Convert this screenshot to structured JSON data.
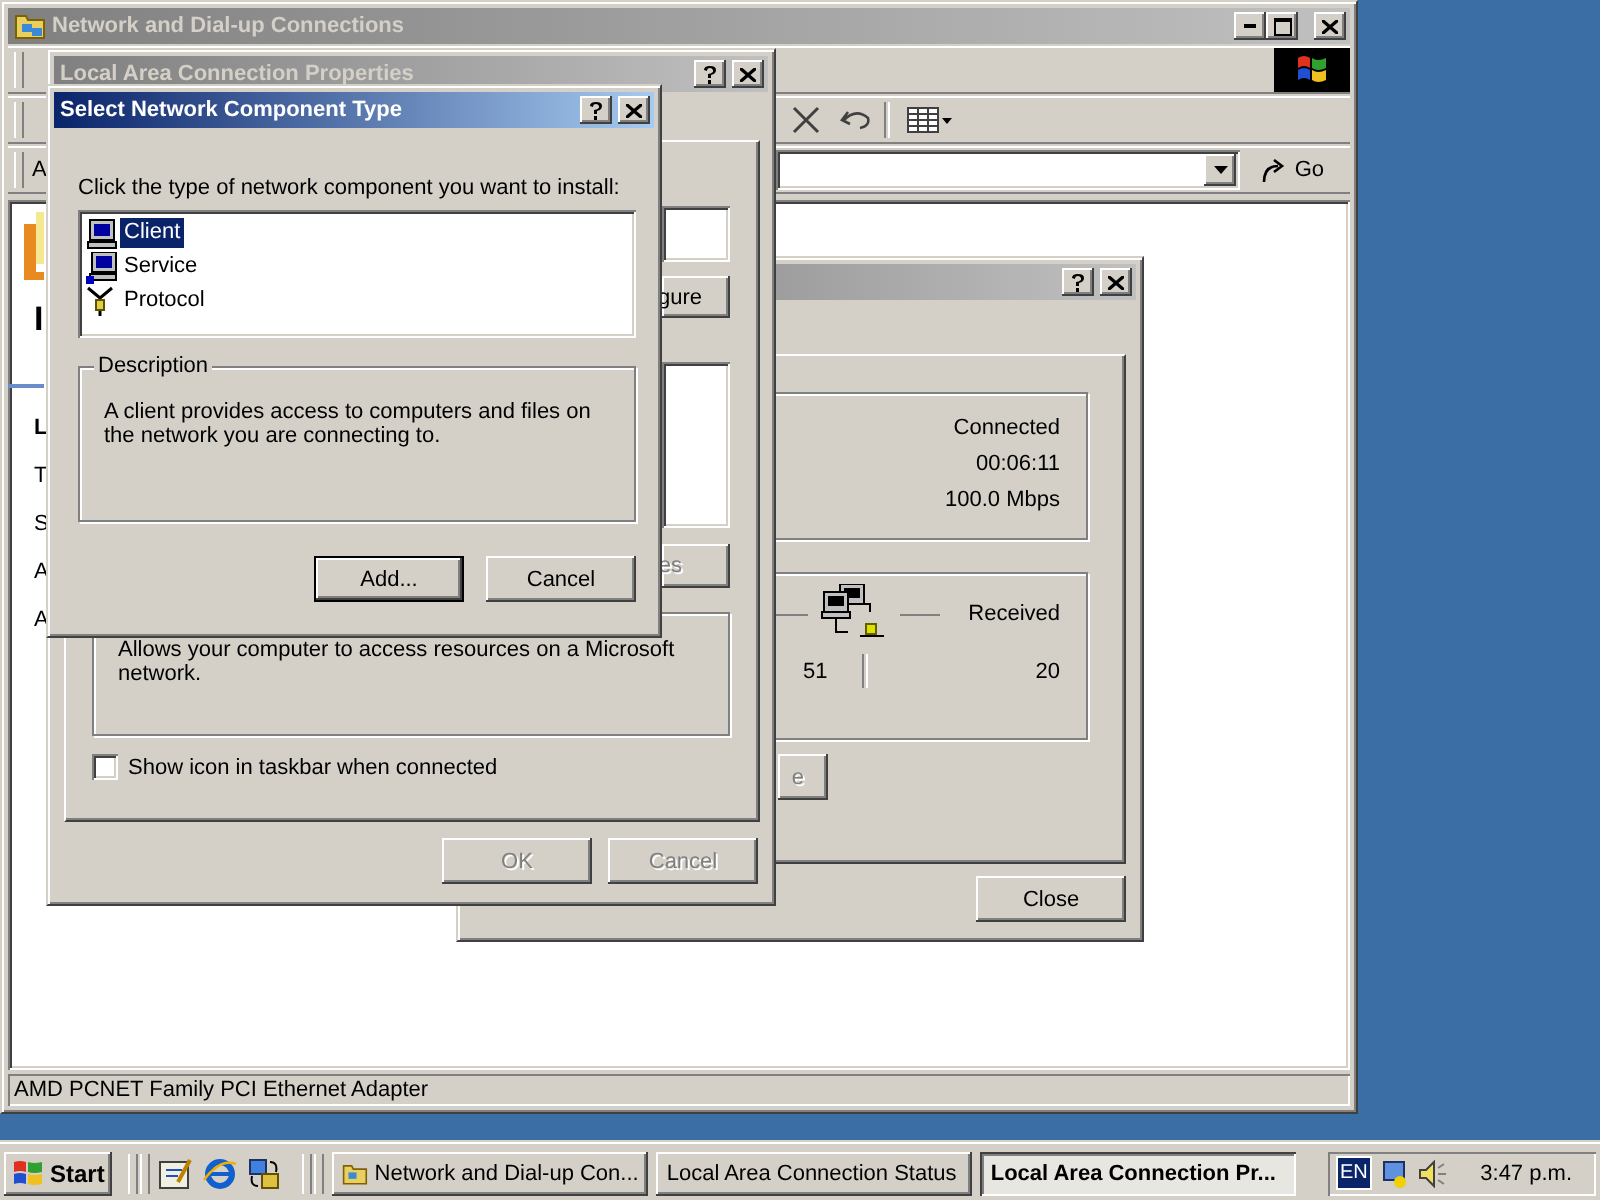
{
  "explorer": {
    "title": "Network and Dial-up Connections",
    "active": false,
    "address_label": "A",
    "go_button": "Go",
    "left_pane": [
      {
        "text": "I",
        "kind": "heading"
      },
      {
        "text": "L",
        "kind": "label"
      },
      {
        "text": "T",
        "kind": "text"
      },
      {
        "text": "S",
        "kind": "text"
      },
      {
        "text": "A",
        "kind": "text"
      },
      {
        "text": "A",
        "kind": "text"
      }
    ],
    "status_bar": "AMD PCNET Family PCI Ethernet Adapter"
  },
  "properties": {
    "title": "Local Area Connection Properties",
    "active": false,
    "configure_button": "gure",
    "properties_button": {
      "label": "es",
      "disabled": true
    },
    "description": "Allows your computer to access resources on a Microsoft network.",
    "show_icon_checkbox": {
      "label": "Show icon in taskbar when connected",
      "checked": false
    },
    "buttons": [
      {
        "label": "OK",
        "disabled": true
      },
      {
        "label": "Cancel",
        "disabled": true
      }
    ]
  },
  "status": {
    "active": false,
    "status_value": "Connected",
    "duration": "00:06:11",
    "speed": "100.0 Mbps",
    "received_label": "Received",
    "sent_count": "51",
    "received_count": "20",
    "disable_button": "e",
    "close_button": "Close"
  },
  "dialog": {
    "title": "Select Network Component Type",
    "active": true,
    "prompt": "Click the type of network component you want to install:",
    "items": [
      {
        "label": "Client",
        "selected": true
      },
      {
        "label": "Service",
        "selected": false
      },
      {
        "label": "Protocol",
        "selected": false
      }
    ],
    "description_label": "Description",
    "description": "A client provides access to computers and files on the network you are connecting to.",
    "buttons": [
      {
        "label": "Add...",
        "default": true
      },
      {
        "label": "Cancel",
        "default": false
      }
    ]
  },
  "taskbar": {
    "start": "Start",
    "tasks": [
      {
        "label": "Network and Dial-up Con...",
        "selected": false
      },
      {
        "label": "Local Area Connection Status",
        "selected": false
      },
      {
        "label": "Local Area Connection Pr...",
        "selected": true
      }
    ],
    "language": "EN",
    "clock": "3:47 p.m."
  }
}
